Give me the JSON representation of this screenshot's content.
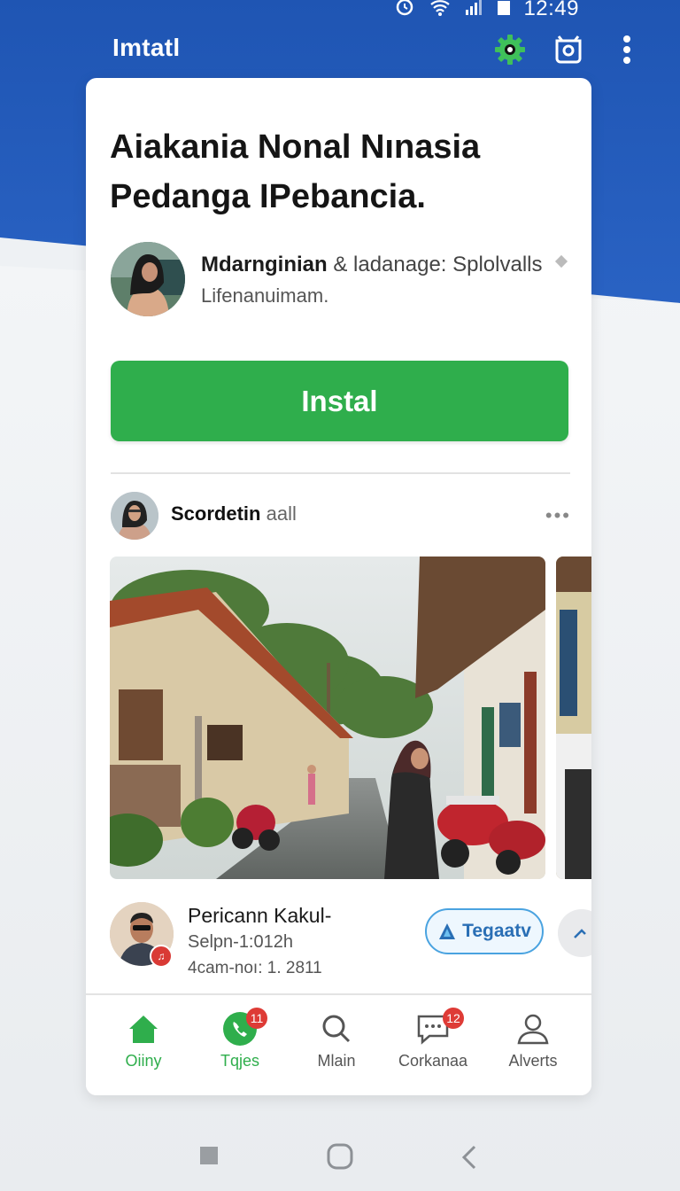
{
  "status_bar": {
    "time": "12:49"
  },
  "app_bar": {
    "title": "Imtatl",
    "icons": [
      "gear-icon",
      "camera-icon",
      "more-vert-icon"
    ]
  },
  "article": {
    "headline": "Aiakania Nonal Nınasia Pedanga IPebancia.",
    "author_name": "Mdarnginian",
    "author_role": "& ladanage: Splolvalls",
    "author_sub": "Lifenanuimam."
  },
  "install_button": {
    "label": "Instal"
  },
  "post": {
    "author": "Scordetin",
    "author_suffix": "aall",
    "more": "•••"
  },
  "comment": {
    "name": "Pericann Kakul-",
    "line2": "Selpn-1:012h",
    "line3": "4cam-noı: 1. 2811",
    "tag_label": "Tegaatv"
  },
  "bottom_nav": {
    "items": [
      {
        "label": "Oiiny",
        "icon": "home-icon",
        "active": true
      },
      {
        "label": "Tqjes",
        "icon": "phone-icon",
        "badge": "11"
      },
      {
        "label": "Mlain",
        "icon": "search-icon"
      },
      {
        "label": "Corkanaa",
        "icon": "chat-icon",
        "badge": "12"
      },
      {
        "label": "Alverts",
        "icon": "person-icon"
      }
    ]
  },
  "colors": {
    "header_blue": "#1f55b3",
    "install_green": "#2fae4c",
    "badge_red": "#de3b36",
    "tag_blue": "#4aa3e0"
  }
}
